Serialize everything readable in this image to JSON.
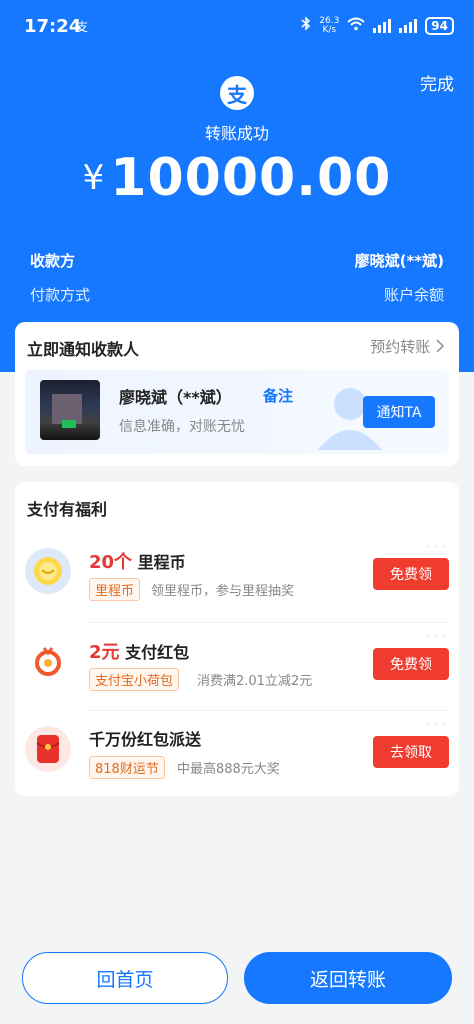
{
  "status_bar": {
    "time": "17:24",
    "alipay_mark": "支",
    "net_speed_value": "26.3",
    "net_speed_unit": "K/s",
    "battery": "94"
  },
  "header": {
    "done_label": "完成",
    "logo_char": "支",
    "success_text": "转账成功",
    "currency": "¥",
    "amount": "10000.00"
  },
  "info": {
    "payee_label": "收款方",
    "payee_value": "廖晓斌(**斌)",
    "method_label": "付款方式",
    "method_value": "账户余额"
  },
  "notify_card": {
    "title": "立即通知收款人",
    "schedule_label": "预约转账",
    "payee_name": "廖晓斌（**斌）",
    "remark_label": "备注",
    "subtitle": "信息准确，对账无忧",
    "notify_button": "通知TA"
  },
  "benefits": {
    "title": "支付有福利",
    "items": [
      {
        "highlight": "20个",
        "title": "里程币",
        "tag": "里程币",
        "desc": "领里程币，参与里程抽奖",
        "button": "免费领",
        "icon": "coin-icon"
      },
      {
        "highlight": "2元",
        "title": "支付红包",
        "tag": "支付宝小荷包",
        "desc": "消费满2.01立减2元",
        "button": "免费领",
        "icon": "wallet-icon"
      },
      {
        "highlight": "",
        "title": "千万份红包派送",
        "tag": "818财运节",
        "desc": "中最高888元大奖",
        "button": "去领取",
        "icon": "red-envelope-icon"
      }
    ]
  },
  "footer": {
    "home_label": "回首页",
    "back_label": "返回转账"
  },
  "colors": {
    "brand_blue": "#1677ff",
    "action_red": "#f03c2f",
    "highlight_red": "#e53935"
  }
}
